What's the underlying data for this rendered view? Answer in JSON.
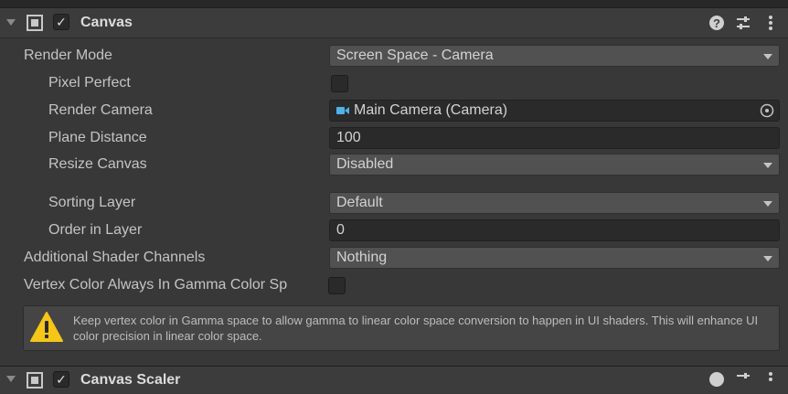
{
  "component": {
    "title": "Canvas",
    "enabled": true,
    "icons": {
      "component": "canvas-icon",
      "help": "help-icon",
      "presets": "presets-icon",
      "menu": "kebab-menu-icon"
    }
  },
  "fields": {
    "render_mode": {
      "label": "Render Mode",
      "value": "Screen Space - Camera"
    },
    "pixel_perfect": {
      "label": "Pixel Perfect",
      "checked": false
    },
    "render_camera": {
      "label": "Render Camera",
      "value": "Main Camera (Camera)"
    },
    "plane_distance": {
      "label": "Plane Distance",
      "value": "100"
    },
    "resize_canvas": {
      "label": "Resize Canvas",
      "value": "Disabled"
    },
    "sorting_layer": {
      "label": "Sorting Layer",
      "value": "Default"
    },
    "order_in_layer": {
      "label": "Order in Layer",
      "value": "0"
    },
    "additional_shader_channels": {
      "label": "Additional Shader Channels",
      "value": "Nothing"
    },
    "vertex_color_gamma": {
      "label": "Vertex Color Always In Gamma Color Sp",
      "checked": false
    }
  },
  "help": {
    "icon": "warning-icon",
    "text": "Keep vertex color in Gamma space to allow gamma to linear color space conversion to happen in UI shaders. This will enhance UI color precision in linear color space."
  },
  "next_component": {
    "title": "Canvas Scaler"
  },
  "colors": {
    "panel": "#383838",
    "header": "#3c3c3c",
    "field": "#2a2a2a",
    "dropdown": "#515151",
    "warning": "#f5c518",
    "camera_icon": "#4fb3e8"
  }
}
